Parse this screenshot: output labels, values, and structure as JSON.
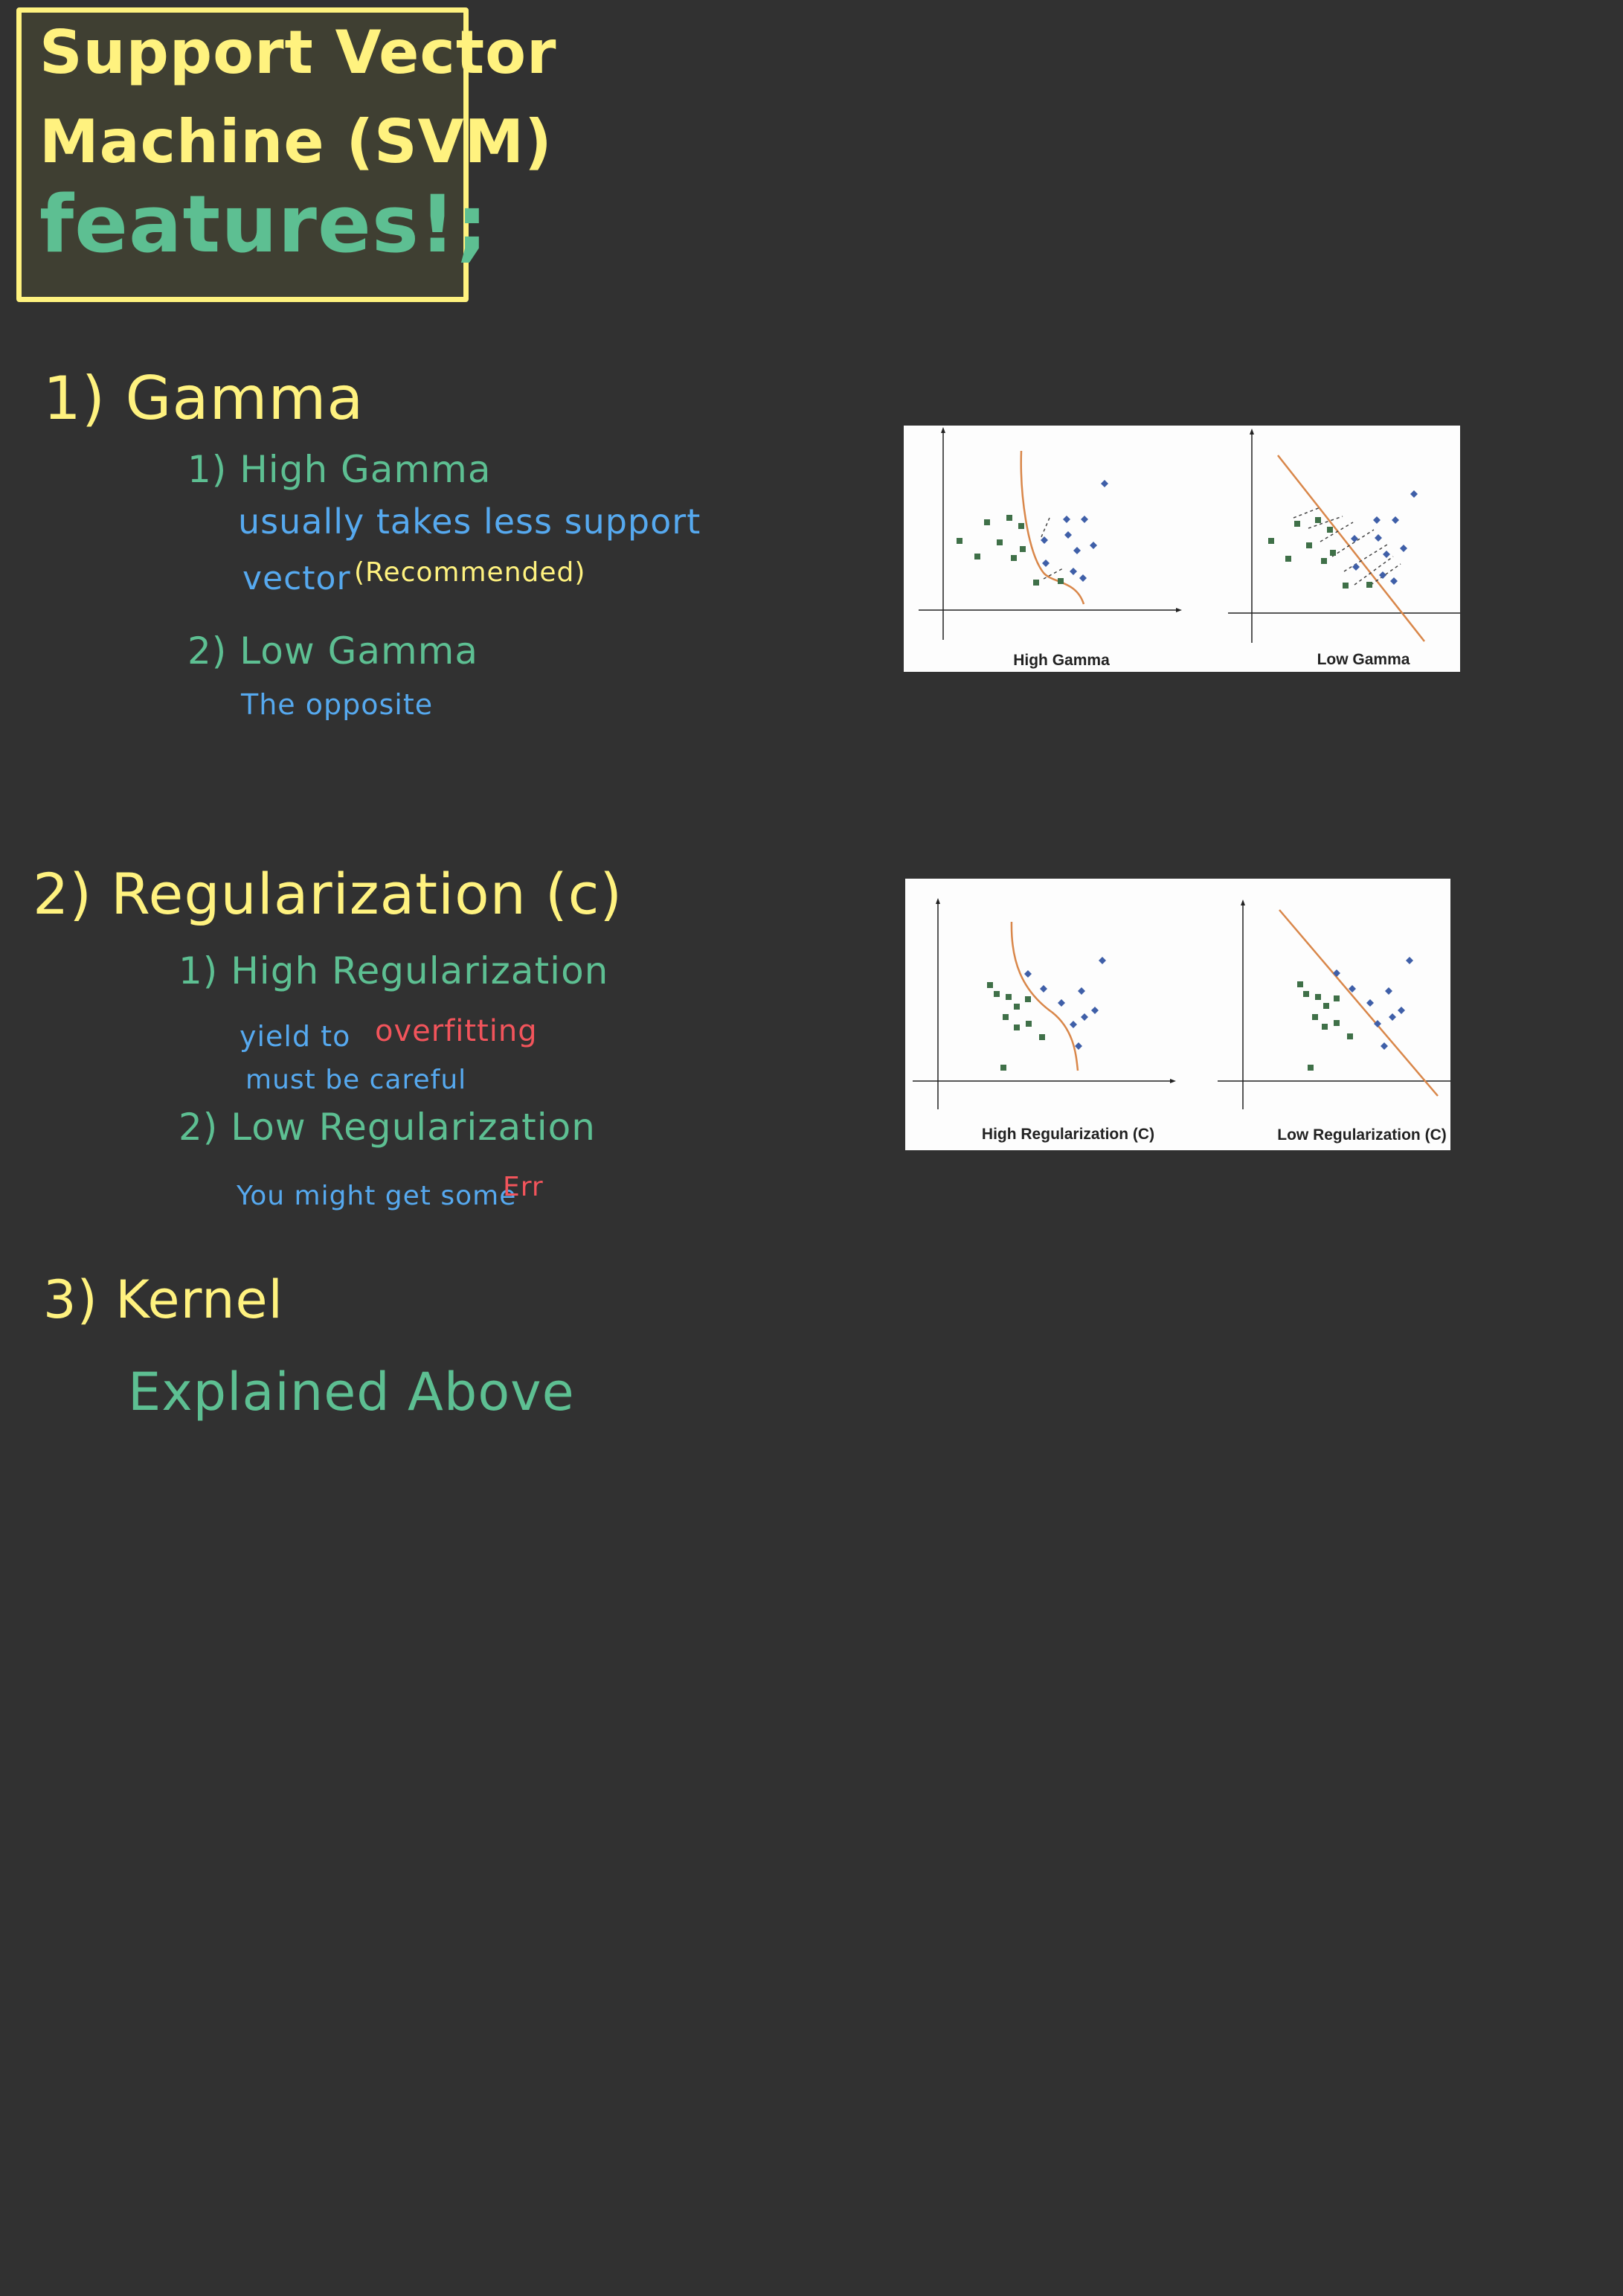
{
  "title": {
    "line1": "Support Vector",
    "line2": "Machine (SVM)",
    "line3": "features!;"
  },
  "sections": [
    {
      "heading": "1) Gamma",
      "items": [
        {
          "label": "1) High Gamma",
          "lines": [
            "usually takes less support",
            "vector"
          ],
          "note": "(Recommended)"
        },
        {
          "label": "2) Low Gamma",
          "lines": [
            "The opposite"
          ]
        }
      ]
    },
    {
      "heading": "2) Regularization (c)",
      "items": [
        {
          "label": "1) High Regularization",
          "line_pre": "yield to",
          "line_red": "overfitting",
          "line2": "must be careful"
        },
        {
          "label": "2) Low Regularization",
          "line_pre": "You might get some",
          "line_red": "Err"
        }
      ]
    },
    {
      "heading": "3) Kernel",
      "body": "Explained Above"
    }
  ],
  "figures": {
    "gamma": {
      "left_caption": "High Gamma",
      "right_caption": "Low Gamma"
    },
    "regularization": {
      "left_caption": "High Regularization (C)",
      "right_caption": "Low Regularization (C)"
    }
  },
  "colors": {
    "background": "#313131",
    "heading": "#fff27f",
    "subheading": "#5dbf92",
    "note": "#56a9ef",
    "warning": "#f2545b",
    "class_a": "#3f7048",
    "class_b": "#3f5fa8",
    "boundary": "#d9874a"
  }
}
